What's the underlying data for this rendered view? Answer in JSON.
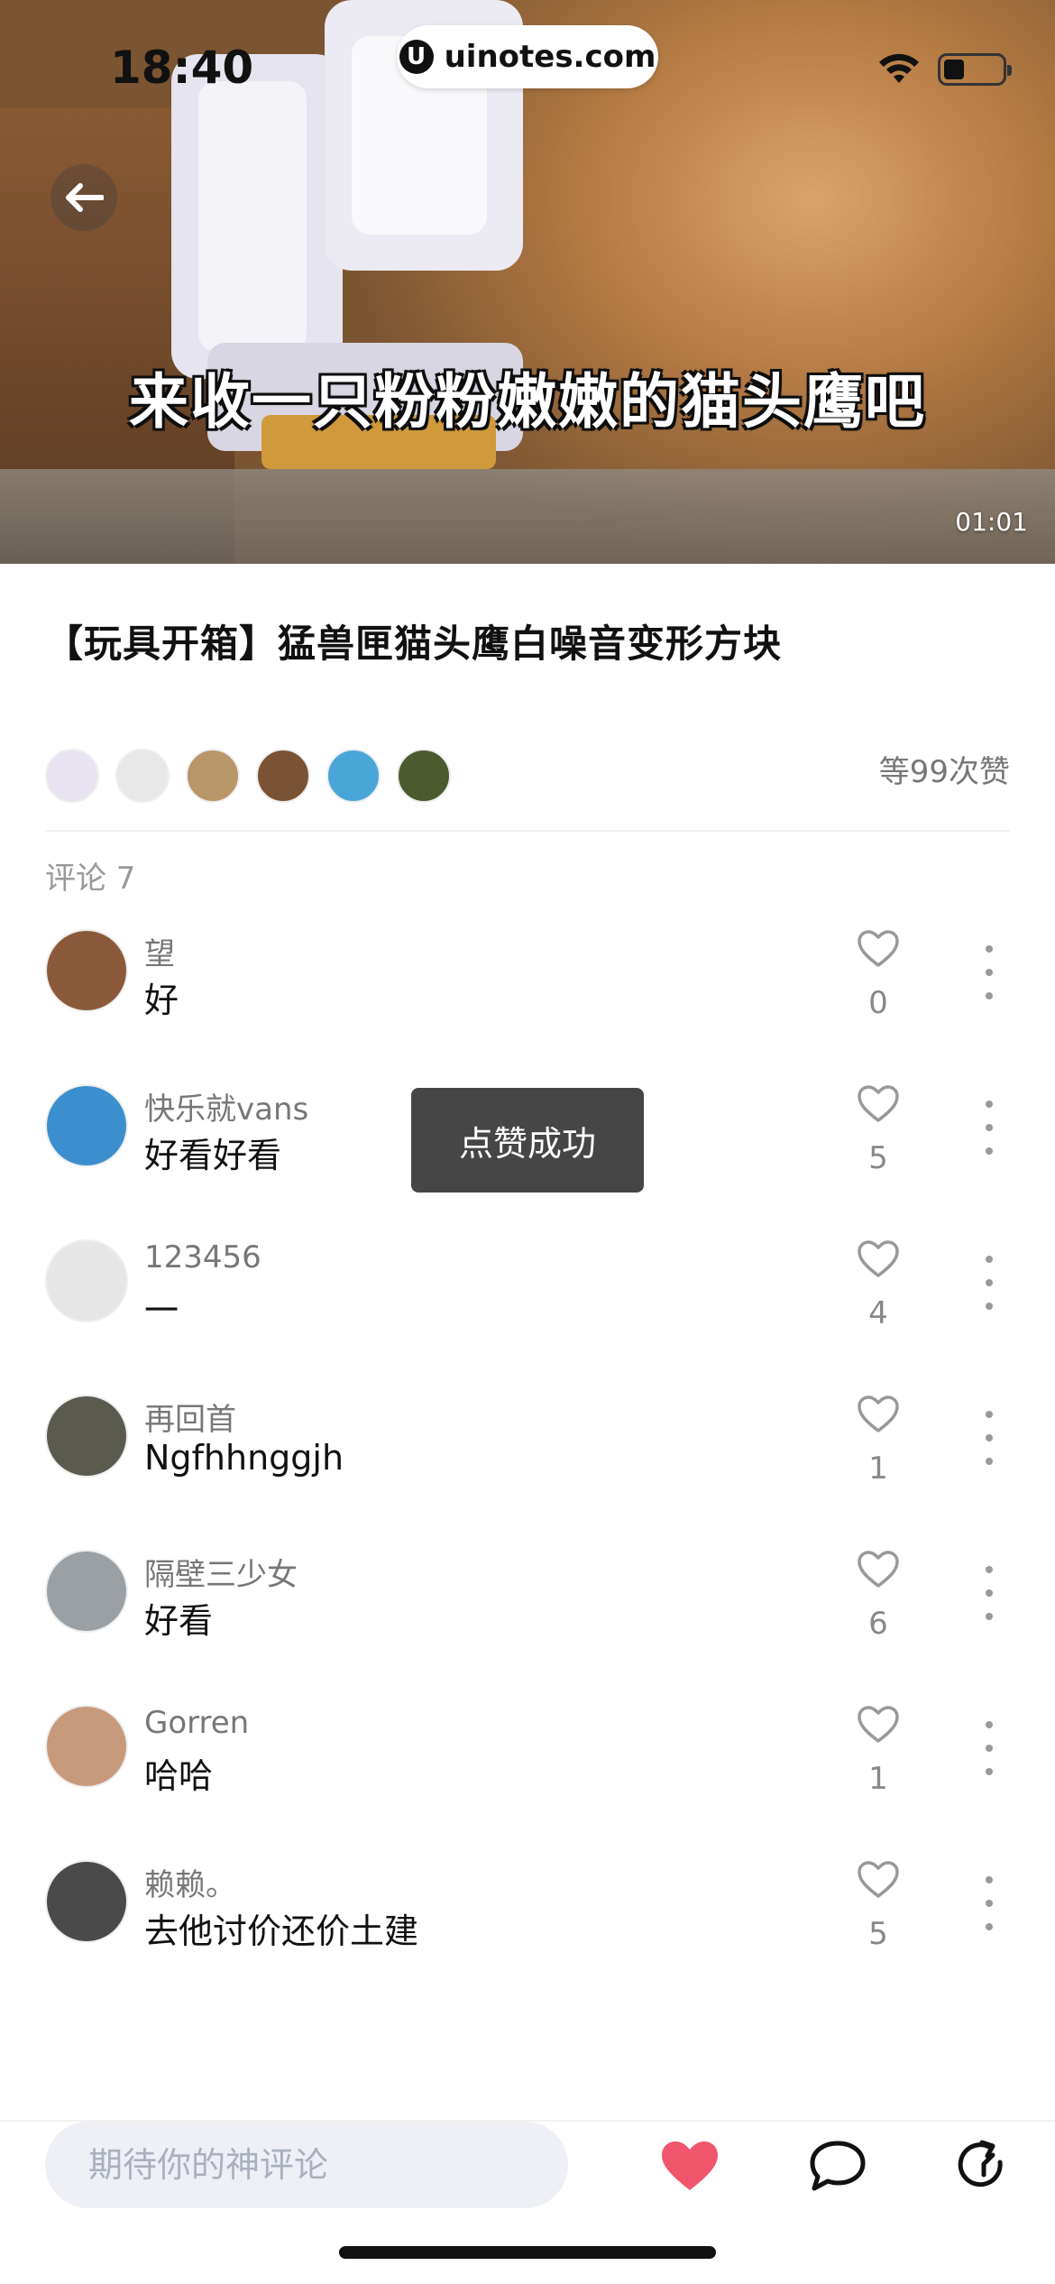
{
  "status_bar": {
    "time": "18:40",
    "url": "uinotes.com",
    "logo_letter": "U"
  },
  "video": {
    "subtitle": "来收一只粉粉嫩嫩的猫头鹰吧",
    "duration": "01:01"
  },
  "post": {
    "title": "【玩具开箱】猛兽匣猫头鹰白噪音变形方块",
    "like_count_label": "等99次赞"
  },
  "likers": [
    {
      "name": "liker-1",
      "color": "#e9e4f2"
    },
    {
      "name": "liker-2",
      "color": "#e8e8e8"
    },
    {
      "name": "liker-3",
      "color": "#b9956a"
    },
    {
      "name": "liker-4",
      "color": "#7a5234"
    },
    {
      "name": "liker-5",
      "color": "#4aa6d8"
    },
    {
      "name": "liker-6",
      "color": "#4c5a2e"
    }
  ],
  "comments_header": "评论 7",
  "comments": [
    {
      "name": "望",
      "text": "好",
      "likes": "0",
      "avatar_color": "#8b5a3a"
    },
    {
      "name": "快乐就vans",
      "text": "好看好看",
      "likes": "5",
      "avatar_color": "#3c8fcf"
    },
    {
      "name": "123456",
      "text": "一",
      "likes": "4",
      "avatar_color": "#e6e6e6"
    },
    {
      "name": "再回首",
      "text": "Ngfhhnggjh",
      "likes": "1",
      "avatar_color": "#5a5a4e"
    },
    {
      "name": "隔壁三少女",
      "text": "好看",
      "likes": "6",
      "avatar_color": "#9aa0a4"
    },
    {
      "name": "Gorren",
      "text": "哈哈",
      "likes": "1",
      "avatar_color": "#c89a7c"
    },
    {
      "name": "赖赖。",
      "text": "去他讨价还价土建",
      "likes": "5",
      "avatar_color": "#4a4a4a"
    }
  ],
  "toast": "点赞成功",
  "bottom_bar": {
    "input_placeholder": "期待你的神评论"
  },
  "colors": {
    "liked_heart": "#f0566b",
    "accent_text": "#111111"
  },
  "icons": [
    "back-arrow-icon",
    "wifi-icon",
    "battery-icon",
    "heart-outline-icon",
    "more-vertical-icon",
    "heart-filled-icon",
    "chat-bubble-icon",
    "share-icon"
  ]
}
